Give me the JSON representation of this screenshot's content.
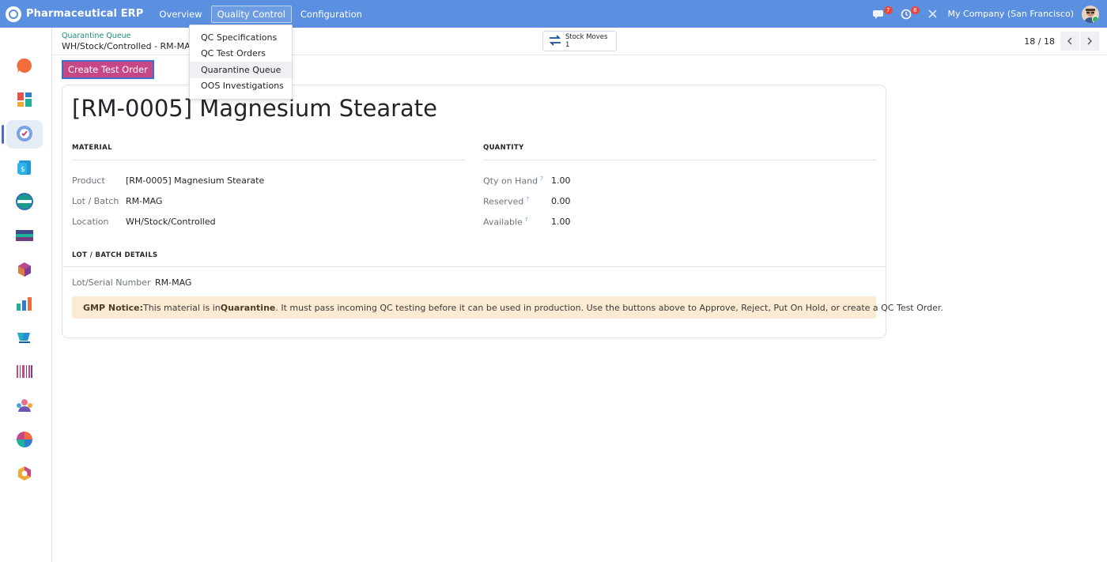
{
  "app": {
    "brand": "Pharmaceutical ERP",
    "menu": [
      "Overview",
      "Quality Control",
      "Configuration"
    ],
    "active_menu_index": 1
  },
  "topbar": {
    "chat_badge": "7",
    "activity_badge": "8",
    "company": "My Company (San Francisco)"
  },
  "dropdown": {
    "items": [
      "QC Specifications",
      "QC Test Orders",
      "Quarantine Queue",
      "OOS Investigations"
    ],
    "focused_index": 2
  },
  "breadcrumb": {
    "parent": "Quarantine Queue",
    "current": "WH/Stock/Controlled - RM-MAG"
  },
  "smart_button": {
    "label": "Stock Moves",
    "count": "1"
  },
  "pager": {
    "value": "18 / 18"
  },
  "actions": {
    "create_test_order": "Create Test Order"
  },
  "record": {
    "title": "[RM-0005] Magnesium Stearate",
    "material_heading": "MATERIAL",
    "quantity_heading": "QUANTITY",
    "lot_heading": "LOT / BATCH DETAILS",
    "product_label": "Product",
    "product_value": "[RM-0005] Magnesium Stearate",
    "lot_label": "Lot / Batch",
    "lot_value": "RM-MAG",
    "location_label": "Location",
    "location_value": "WH/Stock/Controlled",
    "qty_on_hand_label": "Qty on Hand",
    "qty_on_hand_value": "1.00",
    "reserved_label": "Reserved",
    "reserved_value": "0.00",
    "available_label": "Available",
    "available_value": "1.00",
    "help_mark": "?",
    "serial_label": "Lot/Serial Number",
    "serial_value": "RM-MAG"
  },
  "notice": {
    "prefix": "GMP Notice:",
    "text1": " This material is in ",
    "emphasis": "Quarantine",
    "text2": ". It must pass incoming QC testing before it can be used in production. Use the buttons above to Approve, Reject, Put On Hold, or create a QC Test Order."
  },
  "colors": {
    "topbar": "#5b8fdf",
    "primary_button": "#c74685",
    "notice_bg": "#fcebd3",
    "breadcrumb_link": "#1f8a7a"
  }
}
